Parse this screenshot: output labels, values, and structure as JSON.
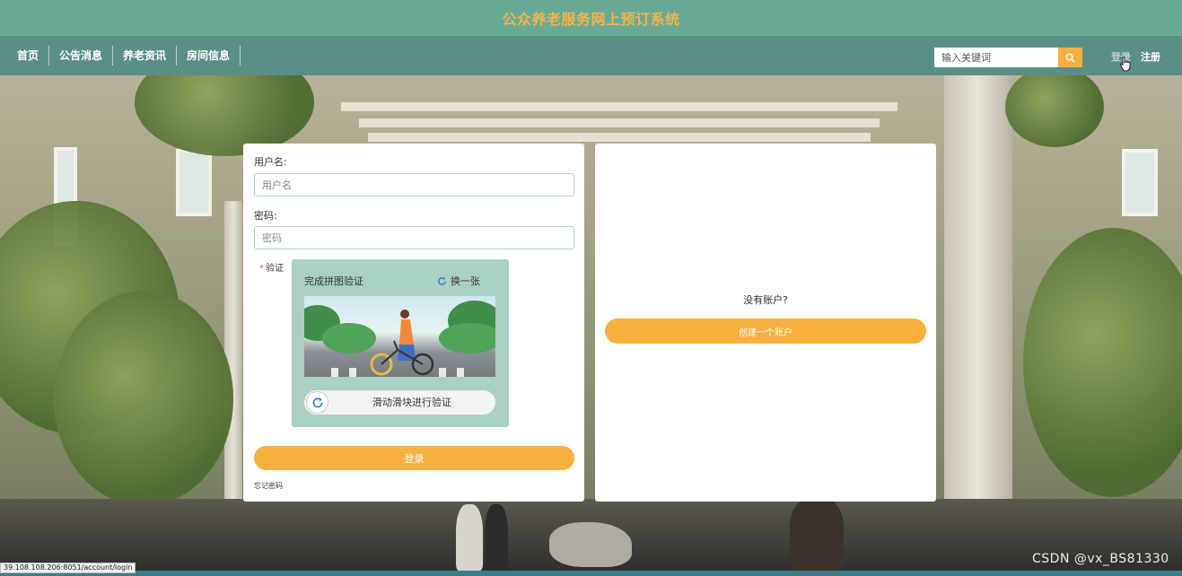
{
  "header": {
    "title": "公众养老服务网上预订系统"
  },
  "nav": {
    "items": [
      {
        "label": "首页"
      },
      {
        "label": "公告消息"
      },
      {
        "label": "养老资讯"
      },
      {
        "label": "房间信息"
      }
    ],
    "search_placeholder": "输入关键词",
    "login_label": "登录",
    "register_label": "注册"
  },
  "login_form": {
    "username_label": "用户名:",
    "username_placeholder": "用户名",
    "password_label": "密码:",
    "password_placeholder": "密码",
    "verify_label": "验证",
    "captcha": {
      "title": "完成拼图验证",
      "refresh_label": "换一张",
      "slider_text": "滑动滑块进行验证"
    },
    "submit_label": "登录",
    "forgot_label": "忘记密码"
  },
  "register_panel": {
    "prompt": "没有账户?",
    "create_label": "创建一个账户"
  },
  "browser": {
    "status_url": "39.108.108.206:8051/account/login",
    "watermark": "CSDN @vx_BS81330"
  },
  "colors": {
    "accent": "#f6b040",
    "title_bar": "#6aab98",
    "nav_bar": "#5a8f88",
    "captcha_bg": "#a9d0c3"
  }
}
